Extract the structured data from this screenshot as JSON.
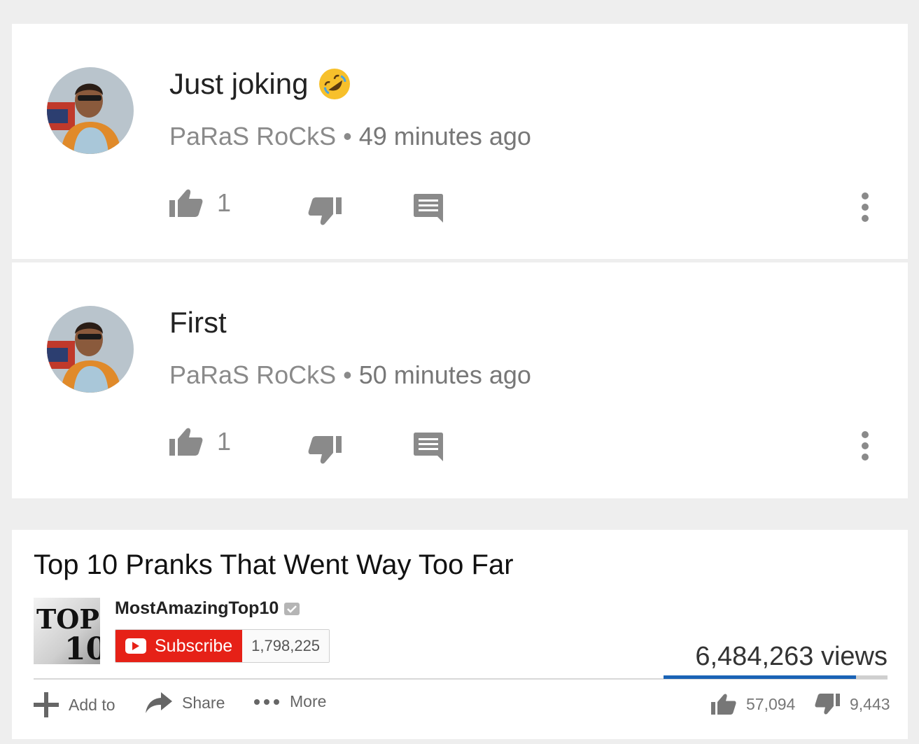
{
  "comments": [
    {
      "text": "Just joking",
      "emoji": "rolling-on-floor-laughing",
      "author": "PaRaS RoCkS",
      "time": "49 minutes ago",
      "likes": "1"
    },
    {
      "text": "First",
      "author": "PaRaS RoCkS",
      "time": "50 minutes ago",
      "likes": "1"
    }
  ],
  "separator": "•",
  "icons": {
    "like": "thumbs-up-icon",
    "dislike": "thumbs-down-icon",
    "reply": "comment-icon",
    "more": "vertical-dots-icon",
    "add": "plus-icon",
    "share": "share-arrow-icon",
    "more_horizontal": "horizontal-dots-icon"
  },
  "video": {
    "title": "Top 10 Pranks That Went Way Too Far",
    "channel": "MostAmazingTop10",
    "channel_logo_text": "TOP 10",
    "subscribe_label": "Subscribe",
    "subscriber_count": "1,798,225",
    "views": "6,484,263 views",
    "likes": "57,094",
    "dislikes": "9,443",
    "like_ratio": 0.858,
    "actions": {
      "add_to": "Add to",
      "share": "Share",
      "more": "More"
    }
  },
  "colors": {
    "background": "#eeeeee",
    "card": "#ffffff",
    "icon_gray": "#8a8a8a",
    "subscribe_red": "#e62117",
    "like_bar_blue": "#1a63b6"
  }
}
